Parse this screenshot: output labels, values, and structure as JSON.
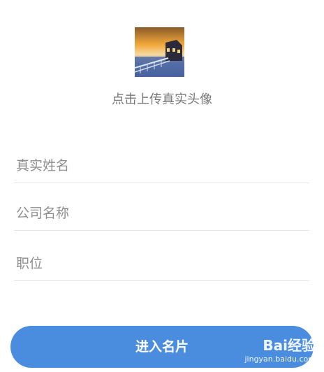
{
  "avatar": {
    "upload_hint": "点击上传真实头像"
  },
  "form": {
    "name_placeholder": "真实姓名",
    "company_placeholder": "公司名称",
    "position_placeholder": "职位"
  },
  "submit": {
    "label": "进入名片"
  },
  "watermark": {
    "logo": "Bai经验",
    "url": "jingyan.baidu.com"
  },
  "colors": {
    "primary": "#4a8ddf",
    "hint_text": "#777777",
    "divider": "#e6e6e6"
  }
}
